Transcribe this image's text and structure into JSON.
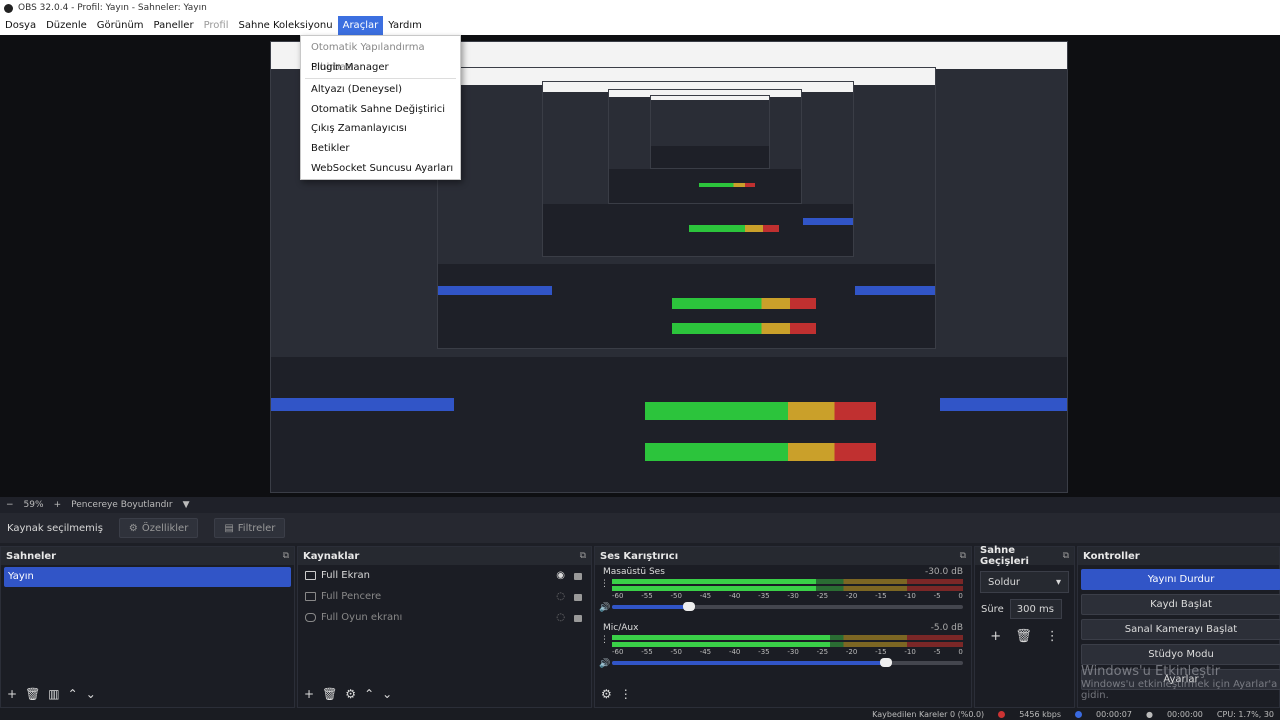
{
  "window": {
    "title": "OBS 32.0.4 - Profil: Yayın - Sahneler: Yayın"
  },
  "menu": {
    "items": [
      {
        "label": "Dosya",
        "state": "normal"
      },
      {
        "label": "Düzenle",
        "state": "normal"
      },
      {
        "label": "Görünüm",
        "state": "normal"
      },
      {
        "label": "Paneller",
        "state": "normal"
      },
      {
        "label": "Profil",
        "state": "disabled"
      },
      {
        "label": "Sahne Koleksiyonu",
        "state": "normal"
      },
      {
        "label": "Araçlar",
        "state": "active"
      },
      {
        "label": "Yardım",
        "state": "normal"
      }
    ]
  },
  "tools_menu": {
    "items": [
      {
        "label": "Otomatik Yapılandırma Sihirbazı",
        "disabled": true
      },
      {
        "label": "Plugin Manager",
        "disabled": false
      },
      {
        "label": "Altyazı (Deneysel)",
        "disabled": false
      },
      {
        "label": "Otomatik Sahne Değiştirici",
        "disabled": false
      },
      {
        "label": "Çıkış Zamanlayıcısı",
        "disabled": false
      },
      {
        "label": "Betikler",
        "disabled": false
      },
      {
        "label": "WebSocket Suncusu Ayarları",
        "disabled": false
      }
    ]
  },
  "zoom": {
    "minus": "−",
    "value": "59%",
    "plus": "+",
    "mode": "Pencereye Boyutlandır"
  },
  "source_toolbar": {
    "status": "Kaynak seçilmemiş",
    "properties": "Özellikler",
    "filters": "Filtreler"
  },
  "scenes": {
    "title": "Sahneler",
    "items": [
      "Yayın"
    ]
  },
  "sources": {
    "title": "Kaynaklar",
    "items": [
      {
        "label": "Full Ekran",
        "visible": true
      },
      {
        "label": "Full Pencere",
        "visible": false
      },
      {
        "label": "Full Oyun ekranı",
        "visible": false
      }
    ]
  },
  "mixer": {
    "title": "Ses Karıştırıcı",
    "ticks": [
      "-60",
      "-55",
      "-50",
      "-45",
      "-40",
      "-35",
      "-30",
      "-25",
      "-20",
      "-15",
      "-10",
      "-5",
      "0"
    ],
    "channels": [
      {
        "name": "Masaüstü Ses",
        "db": "-30.0 dB",
        "level": 0.58,
        "volume": 0.22
      },
      {
        "name": "Mic/Aux",
        "db": "-5.0 dB",
        "level": 0.62,
        "volume": 0.78
      }
    ]
  },
  "transitions": {
    "title": "Sahne Geçişleri",
    "selected": "Soldur",
    "duration_label": "Süre",
    "duration": "300 ms"
  },
  "controls": {
    "title": "Kontroller",
    "buttons": [
      "Yayını Durdur",
      "Kaydı Başlat",
      "Sanal Kamerayı Başlat",
      "Stüdyo Modu",
      "Ayarlar"
    ]
  },
  "watermark": {
    "line1": "Windows'u Etkinleştir",
    "line2": "Windows'u etkinleştirmek için Ayarlar'a gidin."
  },
  "status": {
    "dropped": "Kaybedilen Kareler 0 (%0.0)",
    "bitrate": "5456 kbps",
    "stream_time": "00:00:07",
    "rec_time": "00:00:00",
    "cpu": "CPU: 1.7%, 30"
  }
}
